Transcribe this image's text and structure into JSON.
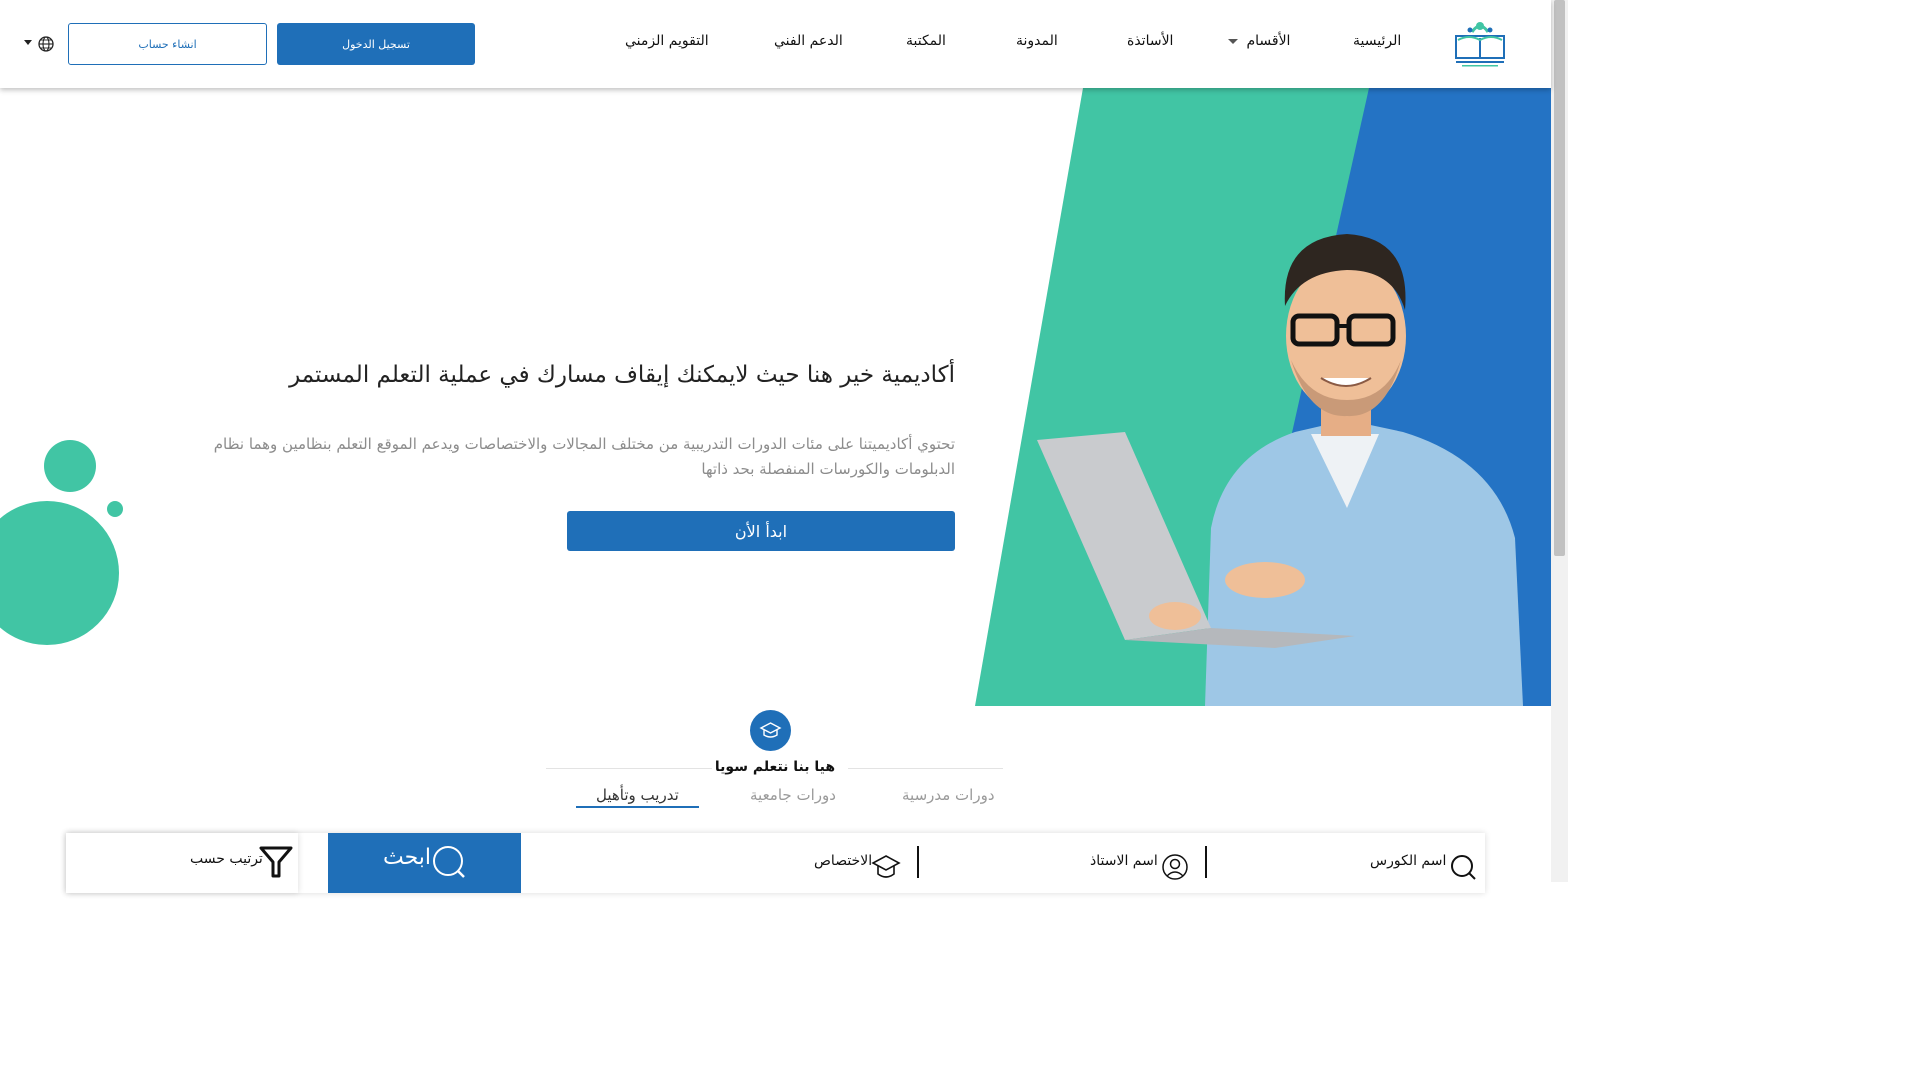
{
  "header": {
    "logo_alt": "أكاديمية خير",
    "nav": [
      {
        "label": "الرئيسية"
      },
      {
        "label": "الأقسام"
      },
      {
        "label": "الأساتذة"
      },
      {
        "label": "المدونة"
      },
      {
        "label": "المكتبة"
      },
      {
        "label": "الدعم الفني"
      },
      {
        "label": "التقويم الزمني"
      }
    ],
    "login_label": "تسجيل الدخول",
    "register_label": "انشاء حساب",
    "language_icon": "globe-icon"
  },
  "hero": {
    "title": "أكاديمية خير هنا حيث لايمكنك إيقاف مسارك في عملية التعلم المستمر",
    "description": "تحتوي أكاديميتنا على مئات الدورات التدريبية من مختلف المجالات والاختصاصات ويدعم الموقع التعلم بنظامين وهما نظام الدبلومات والكورسات المنفصلة بحد ذاتها",
    "cta_label": "ابدأ الأن"
  },
  "section": {
    "icon": "graduation-cap-icon",
    "title": "هيا بنا نتعلم سويا",
    "tabs": [
      {
        "label": "دورات مدرسية",
        "active": false
      },
      {
        "label": "دورات جامعية",
        "active": false
      },
      {
        "label": "تدريب وتأهيل",
        "active": true
      }
    ]
  },
  "search": {
    "course_name_label": "اسم الكورس",
    "teacher_name_label": "اسم الاستاذ",
    "specialty_label": "الاختصاص",
    "search_label": "ابحث",
    "sort_label": "ترتيب حسب"
  },
  "colors": {
    "primary": "#1f6fb8",
    "accent": "#41c5a4",
    "hero_blue": "#2473c4"
  }
}
